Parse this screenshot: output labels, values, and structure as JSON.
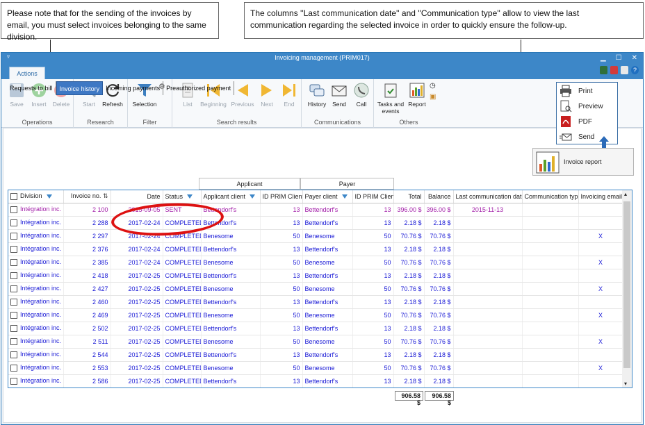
{
  "callouts": {
    "left": "Please note that for the sending of the invoices by email, you must select invoices belonging to the same division.",
    "right": "The columns ''Last communication date'' and ''Communication type'' allow to view the last communication regarding the selected invoice in order to quickly ensure the follow-up."
  },
  "window": {
    "title": "Invoicing management (PRIM017)",
    "tab": "Actions"
  },
  "ribbon": {
    "groups": {
      "operations": "Operations",
      "research": "Research",
      "filter": "Filter",
      "search_results": "Search results",
      "communications": "Communications",
      "others": "Others"
    },
    "buttons": {
      "save": "Save",
      "insert": "Insert",
      "delete": "Delete",
      "start": "Start",
      "refresh": "Refresh",
      "selection": "Selection",
      "list": "List",
      "beginning": "Beginning",
      "previous": "Previous",
      "next": "Next",
      "end": "End",
      "history": "History",
      "send": "Send",
      "call": "Call",
      "tasks": "Tasks and events",
      "report": "Report"
    }
  },
  "dropdown": {
    "print": "Print",
    "preview": "Preview",
    "pdf": "PDF",
    "send": "Send"
  },
  "invoice_report": "Invoice report",
  "subtabs": [
    "Requests to bill",
    "Invoice history",
    "Incoming payments",
    "Preauthorized payment"
  ],
  "group_headers": {
    "applicant": "Applicant",
    "payer": "Payer"
  },
  "columns": [
    "Division",
    "Invoice no.",
    "Date",
    "Status",
    "Applicant client",
    "ID PRIM Client",
    "Payer client",
    "ID PRIM Client",
    "Total",
    "Balance",
    "Last communication date",
    "Communication type",
    "Invoicing email"
  ],
  "rows": [
    [
      "Intégration inc.",
      "2 100",
      "2015-09-05",
      "SENT",
      "Bettendorf's",
      "13",
      "Bettendorf's",
      "13",
      "396.00 $",
      "396.00 $",
      "2015-11-13",
      "",
      ""
    ],
    [
      "Intégration inc.",
      "2 288",
      "2017-02-24",
      "COMPLETED",
      "Bettendorf's",
      "13",
      "Bettendorf's",
      "13",
      "2.18 $",
      "2.18 $",
      "",
      "",
      ""
    ],
    [
      "Intégration inc.",
      "2 297",
      "2017-02-24",
      "COMPLETED",
      "Benesome",
      "50",
      "Benesome",
      "50",
      "70.76 $",
      "70.76 $",
      "",
      "",
      "X"
    ],
    [
      "Intégration inc.",
      "2 376",
      "2017-02-24",
      "COMPLETED",
      "Bettendorf's",
      "13",
      "Bettendorf's",
      "13",
      "2.18 $",
      "2.18 $",
      "",
      "",
      ""
    ],
    [
      "Intégration inc.",
      "2 385",
      "2017-02-24",
      "COMPLETED",
      "Benesome",
      "50",
      "Benesome",
      "50",
      "70.76 $",
      "70.76 $",
      "",
      "",
      "X"
    ],
    [
      "Intégration inc.",
      "2 418",
      "2017-02-25",
      "COMPLETED",
      "Bettendorf's",
      "13",
      "Bettendorf's",
      "13",
      "2.18 $",
      "2.18 $",
      "",
      "",
      ""
    ],
    [
      "Intégration inc.",
      "2 427",
      "2017-02-25",
      "COMPLETED",
      "Benesome",
      "50",
      "Benesome",
      "50",
      "70.76 $",
      "70.76 $",
      "",
      "",
      "X"
    ],
    [
      "Intégration inc.",
      "2 460",
      "2017-02-25",
      "COMPLETED",
      "Bettendorf's",
      "13",
      "Bettendorf's",
      "13",
      "2.18 $",
      "2.18 $",
      "",
      "",
      ""
    ],
    [
      "Intégration inc.",
      "2 469",
      "2017-02-25",
      "COMPLETED",
      "Benesome",
      "50",
      "Benesome",
      "50",
      "70.76 $",
      "70.76 $",
      "",
      "",
      "X"
    ],
    [
      "Intégration inc.",
      "2 502",
      "2017-02-25",
      "COMPLETED",
      "Bettendorf's",
      "13",
      "Bettendorf's",
      "13",
      "2.18 $",
      "2.18 $",
      "",
      "",
      ""
    ],
    [
      "Intégration inc.",
      "2 511",
      "2017-02-25",
      "COMPLETED",
      "Benesome",
      "50",
      "Benesome",
      "50",
      "70.76 $",
      "70.76 $",
      "",
      "",
      "X"
    ],
    [
      "Intégration inc.",
      "2 544",
      "2017-02-25",
      "COMPLETED",
      "Bettendorf's",
      "13",
      "Bettendorf's",
      "13",
      "2.18 $",
      "2.18 $",
      "",
      "",
      ""
    ],
    [
      "Intégration inc.",
      "2 553",
      "2017-02-25",
      "COMPLETED",
      "Benesome",
      "50",
      "Benesome",
      "50",
      "70.76 $",
      "70.76 $",
      "",
      "",
      "X"
    ],
    [
      "Intégration inc.",
      "2 586",
      "2017-02-25",
      "COMPLETED",
      "Bettendorf's",
      "13",
      "Bettendorf's",
      "13",
      "2.18 $",
      "2.18 $",
      "",
      "",
      ""
    ]
  ],
  "totals": {
    "total": "906.58 $",
    "balance": "906.58 $"
  }
}
